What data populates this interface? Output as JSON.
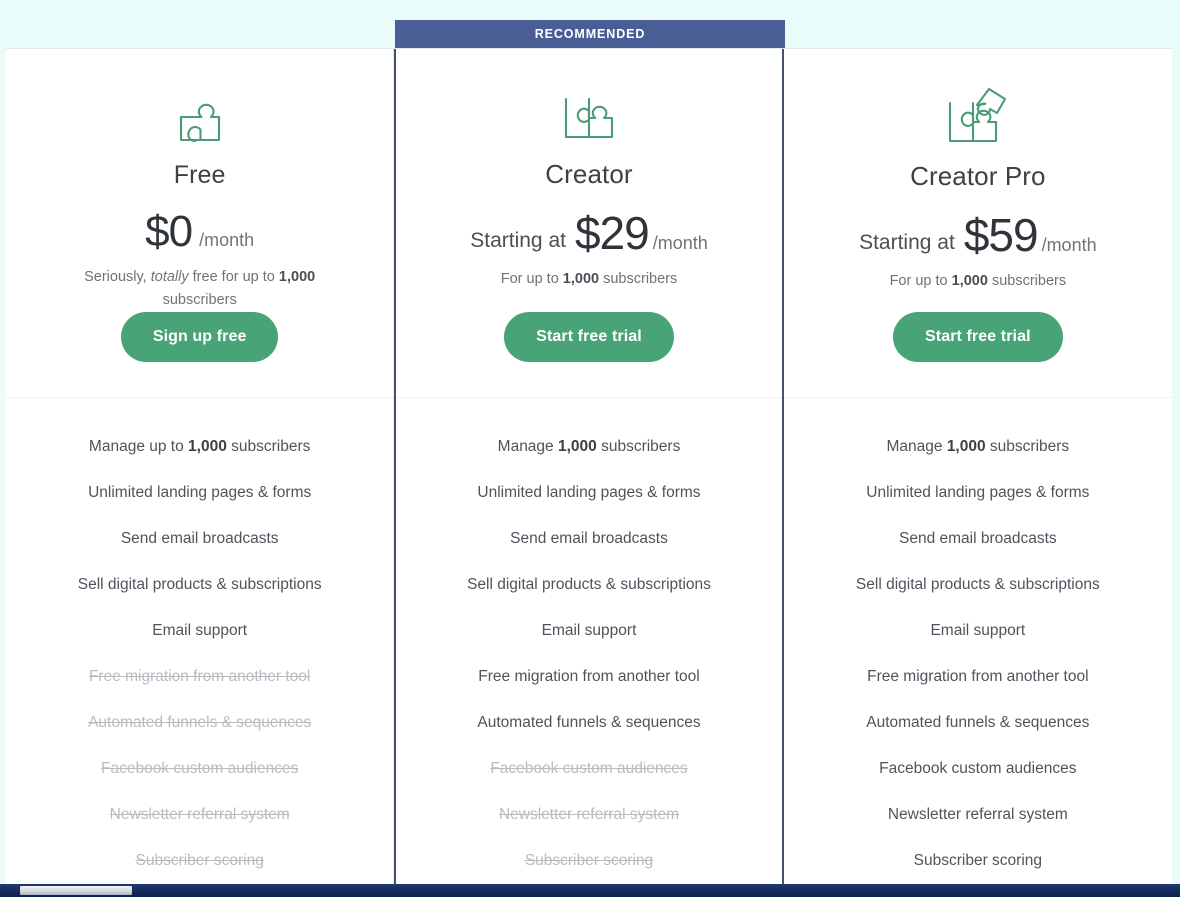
{
  "ribbon": {
    "label": "RECOMMENDED"
  },
  "colors": {
    "page_background": "#e9fcfa",
    "ribbon": "#4a5e96",
    "cta_green": "#48a377",
    "featured_border": "#47536a",
    "disabled_text": "#b7bcc2"
  },
  "plans": [
    {
      "id": "free",
      "icon": "puzzle-one-piece-icon",
      "name": "Free",
      "price_prefix": "",
      "price_amount": "$0",
      "price_period": "/month",
      "note_parts": [
        {
          "text": "Seriously, ",
          "style": "normal"
        },
        {
          "text": "totally",
          "style": "italic"
        },
        {
          "text": " free for up to ",
          "style": "normal"
        },
        {
          "text": "1,000",
          "style": "bold"
        },
        {
          "text": " subscribers",
          "style": "normal"
        }
      ],
      "cta_label": "Sign up free",
      "features": [
        {
          "parts": [
            {
              "text": "Manage up to ",
              "style": "normal"
            },
            {
              "text": "1,000",
              "style": "bold"
            },
            {
              "text": " subscribers",
              "style": "normal"
            }
          ],
          "included": true
        },
        {
          "parts": [
            {
              "text": "Unlimited landing pages & forms",
              "style": "normal"
            }
          ],
          "included": true
        },
        {
          "parts": [
            {
              "text": "Send email broadcasts",
              "style": "normal"
            }
          ],
          "included": true
        },
        {
          "parts": [
            {
              "text": "Sell digital products & subscriptions",
              "style": "normal"
            }
          ],
          "included": true
        },
        {
          "parts": [
            {
              "text": "Email support",
              "style": "normal"
            }
          ],
          "included": true
        },
        {
          "parts": [
            {
              "text": "Free migration from another tool",
              "style": "normal"
            }
          ],
          "included": false
        },
        {
          "parts": [
            {
              "text": "Automated funnels & sequences",
              "style": "normal"
            }
          ],
          "included": false
        },
        {
          "parts": [
            {
              "text": "Facebook custom audiences",
              "style": "normal"
            }
          ],
          "included": false
        },
        {
          "parts": [
            {
              "text": "Newsletter referral system",
              "style": "normal"
            }
          ],
          "included": false
        },
        {
          "parts": [
            {
              "text": "Subscriber scoring",
              "style": "normal"
            }
          ],
          "included": false
        }
      ]
    },
    {
      "id": "creator",
      "icon": "puzzle-two-pieces-icon",
      "name": "Creator",
      "price_prefix": "Starting at",
      "price_amount": "$29",
      "price_period": "/month",
      "note_parts": [
        {
          "text": "For up to ",
          "style": "normal"
        },
        {
          "text": "1,000",
          "style": "bold"
        },
        {
          "text": " subscribers",
          "style": "normal"
        }
      ],
      "cta_label": "Start free trial",
      "features": [
        {
          "parts": [
            {
              "text": "Manage ",
              "style": "normal"
            },
            {
              "text": "1,000",
              "style": "bold"
            },
            {
              "text": " subscribers",
              "style": "normal"
            }
          ],
          "included": true
        },
        {
          "parts": [
            {
              "text": "Unlimited landing pages & forms",
              "style": "normal"
            }
          ],
          "included": true
        },
        {
          "parts": [
            {
              "text": "Send email broadcasts",
              "style": "normal"
            }
          ],
          "included": true
        },
        {
          "parts": [
            {
              "text": "Sell digital products & subscriptions",
              "style": "normal"
            }
          ],
          "included": true
        },
        {
          "parts": [
            {
              "text": "Email support",
              "style": "normal"
            }
          ],
          "included": true
        },
        {
          "parts": [
            {
              "text": "Free migration from another tool",
              "style": "normal"
            }
          ],
          "included": true
        },
        {
          "parts": [
            {
              "text": "Automated funnels & sequences",
              "style": "normal"
            }
          ],
          "included": true
        },
        {
          "parts": [
            {
              "text": "Facebook custom audiences",
              "style": "normal"
            }
          ],
          "included": false
        },
        {
          "parts": [
            {
              "text": "Newsletter referral system",
              "style": "normal"
            }
          ],
          "included": false
        },
        {
          "parts": [
            {
              "text": "Subscriber scoring",
              "style": "normal"
            }
          ],
          "included": false
        }
      ]
    },
    {
      "id": "creator-pro",
      "icon": "puzzle-three-pieces-icon",
      "name": "Creator Pro",
      "price_prefix": "Starting at",
      "price_amount": "$59",
      "price_period": "/month",
      "note_parts": [
        {
          "text": "For up to ",
          "style": "normal"
        },
        {
          "text": "1,000",
          "style": "bold"
        },
        {
          "text": " subscribers",
          "style": "normal"
        }
      ],
      "cta_label": "Start free trial",
      "features": [
        {
          "parts": [
            {
              "text": "Manage ",
              "style": "normal"
            },
            {
              "text": "1,000",
              "style": "bold"
            },
            {
              "text": " subscribers",
              "style": "normal"
            }
          ],
          "included": true
        },
        {
          "parts": [
            {
              "text": "Unlimited landing pages & forms",
              "style": "normal"
            }
          ],
          "included": true
        },
        {
          "parts": [
            {
              "text": "Send email broadcasts",
              "style": "normal"
            }
          ],
          "included": true
        },
        {
          "parts": [
            {
              "text": "Sell digital products & subscriptions",
              "style": "normal"
            }
          ],
          "included": true
        },
        {
          "parts": [
            {
              "text": "Email support",
              "style": "normal"
            }
          ],
          "included": true
        },
        {
          "parts": [
            {
              "text": "Free migration from another tool",
              "style": "normal"
            }
          ],
          "included": true
        },
        {
          "parts": [
            {
              "text": "Automated funnels & sequences",
              "style": "normal"
            }
          ],
          "included": true
        },
        {
          "parts": [
            {
              "text": "Facebook custom audiences",
              "style": "normal"
            }
          ],
          "included": true
        },
        {
          "parts": [
            {
              "text": "Newsletter referral system",
              "style": "normal"
            }
          ],
          "included": true
        },
        {
          "parts": [
            {
              "text": "Subscriber scoring",
              "style": "normal"
            }
          ],
          "included": true
        }
      ]
    }
  ]
}
